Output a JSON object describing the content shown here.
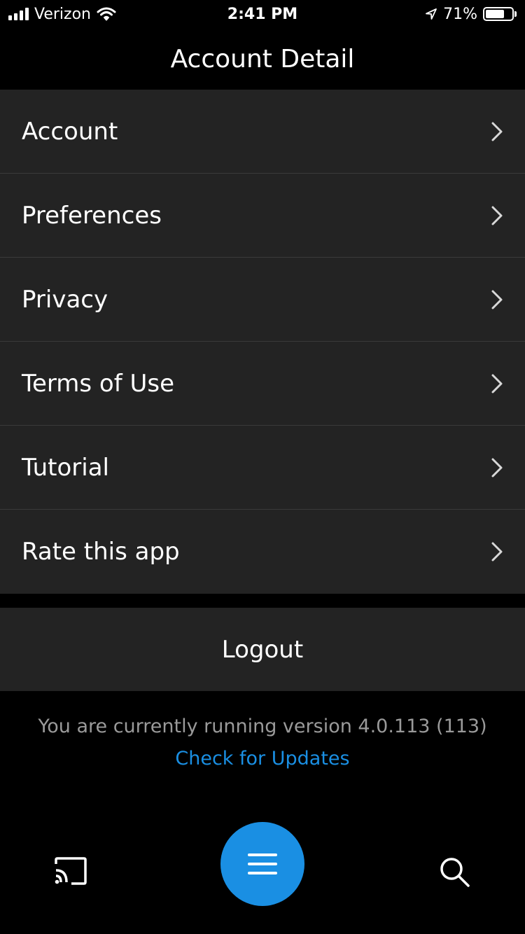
{
  "status_bar": {
    "carrier": "Verizon",
    "time": "2:41 PM",
    "battery": "71%",
    "battery_level": 0.71
  },
  "header": {
    "title": "Account Detail"
  },
  "menu": {
    "items": [
      {
        "label": "Account"
      },
      {
        "label": "Preferences"
      },
      {
        "label": "Privacy"
      },
      {
        "label": "Terms of Use"
      },
      {
        "label": "Tutorial"
      },
      {
        "label": "Rate this app"
      }
    ]
  },
  "logout": {
    "label": "Logout"
  },
  "footer": {
    "version_text": "You are currently running version 4.0.113 (113)",
    "update_link": "Check for Updates"
  },
  "bottom_bar": {
    "icons": [
      "cast-icon",
      "hamburger-menu-icon",
      "search-icon"
    ]
  },
  "colors": {
    "accent": "#1a8fe3",
    "row_background": "#232323",
    "page_background": "#000000",
    "muted_text": "#9a9a9a"
  }
}
